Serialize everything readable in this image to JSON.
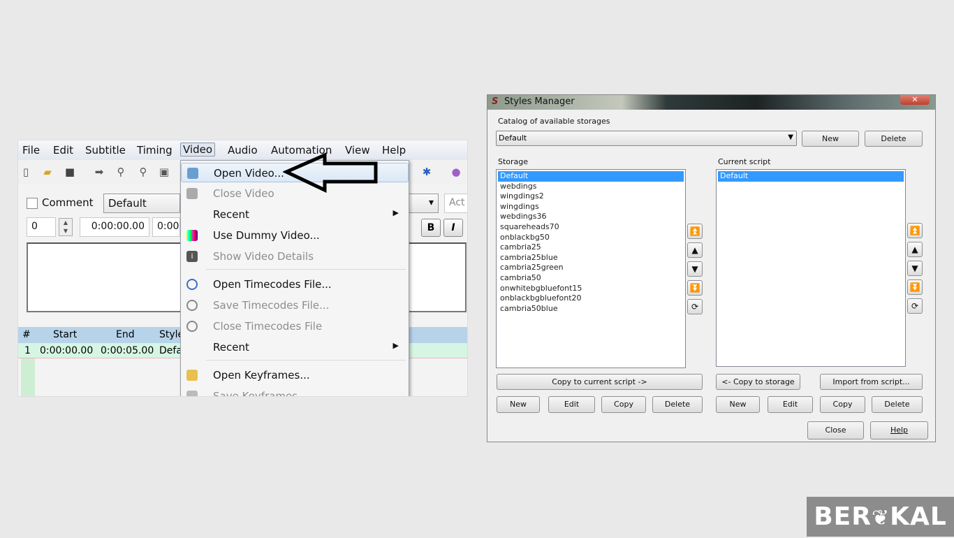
{
  "aegisub": {
    "menubar": [
      "File",
      "Edit",
      "Subtitle",
      "Timing",
      "Video",
      "Audio",
      "Automation",
      "View",
      "Help"
    ],
    "edit_box": {
      "comment_label": "Comment",
      "style_value": "Default",
      "actor_placeholder": "Act",
      "layer_value": "0",
      "start_time": "0:00:00.00",
      "end_time_partial": "0:00",
      "bold_label": "B",
      "italic_label": "I"
    },
    "grid": {
      "headers": [
        "#",
        "Start",
        "End",
        "Style"
      ],
      "rows": [
        [
          "1",
          "0:00:00.00",
          "0:00:05.00",
          "Defa"
        ]
      ]
    },
    "video_menu": [
      {
        "label": "Open Video...",
        "enabled": true,
        "icon": "film-open-icon",
        "highlighted": true
      },
      {
        "label": "Close Video",
        "enabled": false,
        "icon": "film-close-icon"
      },
      {
        "label": "Recent",
        "enabled": true,
        "submenu": true
      },
      {
        "label": "Use Dummy Video...",
        "enabled": true,
        "icon": "color-bars-icon"
      },
      {
        "label": "Show Video Details",
        "enabled": false,
        "icon": "info-icon"
      },
      {
        "label": "Open Timecodes File...",
        "enabled": true,
        "icon": "clock-open-icon"
      },
      {
        "label": "Save Timecodes File...",
        "enabled": false,
        "icon": "clock-save-icon"
      },
      {
        "label": "Close Timecodes File",
        "enabled": false,
        "icon": "clock-close-icon"
      },
      {
        "label": "Recent",
        "enabled": true,
        "submenu": true
      },
      {
        "label": "Open Keyframes...",
        "enabled": true,
        "icon": "key-icon"
      },
      {
        "label": "Save Keyframes...",
        "enabled": false,
        "icon": "key-save-icon"
      }
    ]
  },
  "styles_manager": {
    "title": "Styles Manager",
    "catalog_label": "Catalog of available storages",
    "catalog_value": "Default",
    "catalog_new": "New",
    "catalog_delete": "Delete",
    "storage_label": "Storage",
    "storage_items": [
      "Default",
      "webdings",
      "wingdings2",
      "wingdings",
      "webdings36",
      "squareheads70",
      "onblackbg50",
      "cambria25",
      "cambria25blue",
      "cambria25green",
      "cambria50",
      "onwhitebgbluefont15",
      "onblackbgbluefont20",
      "cambria50blue"
    ],
    "storage_selected": "Default",
    "current_label": "Current script",
    "current_items": [
      "Default"
    ],
    "copy_to_current": "Copy to current script ->",
    "copy_to_storage": "<- Copy to storage",
    "import_from_script": "Import from script...",
    "new": "New",
    "edit": "Edit",
    "copy": "Copy",
    "delete": "Delete",
    "close": "Close",
    "help": "Help",
    "selection_color": "#3399ff"
  },
  "watermark": "BERAKAL"
}
